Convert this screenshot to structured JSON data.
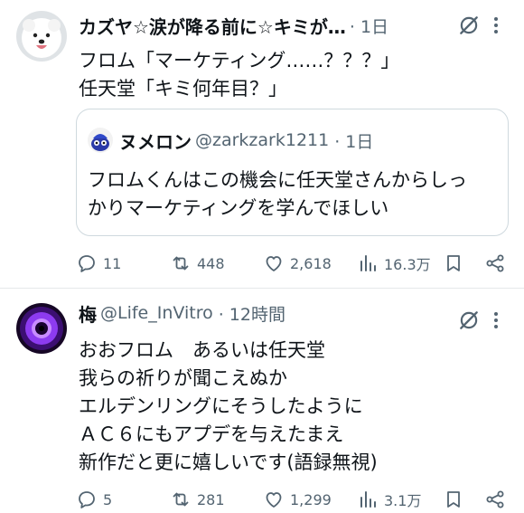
{
  "posts": [
    {
      "display_name": "カズヤ☆涙が降る前に☆キミが…",
      "handle": "",
      "time": "· 1日",
      "text": "フロム「マーケティング……？？？」\n任天堂「キミ何年目？」",
      "quote": {
        "display_name": "ヌメロン",
        "handle": "@zarkzark1211",
        "time": "· 1日",
        "text": "フロムくんはこの機会に任天堂さんからしっ\nかりマーケティングを学んでほしい"
      },
      "stats": {
        "replies": "11",
        "reposts": "448",
        "likes": "2,618",
        "views": "16.3万"
      }
    },
    {
      "display_name": "梅",
      "handle": "@Life_InVitro",
      "time": "· 12時間",
      "text": "おおフロム　あるいは任天堂\n我らの祈りが聞こえぬか\nエルデンリングにそうしたように\nＡＣ６にもアプデを与えたまえ\n新作だと更に嬉しいです(語録無視)",
      "stats": {
        "replies": "5",
        "reposts": "281",
        "likes": "1,299",
        "views": "3.1万"
      }
    }
  ],
  "icons": {
    "reply": "reply-icon",
    "repost": "repost-icon",
    "like": "heart-icon",
    "views": "views-chart-icon",
    "bookmark": "bookmark-icon",
    "share": "share-icon",
    "grok": "grok-icon",
    "more": "more-dots-icon"
  },
  "colors": {
    "text": "#0f1419",
    "secondary": "#536471",
    "border": "#cfd9de"
  }
}
